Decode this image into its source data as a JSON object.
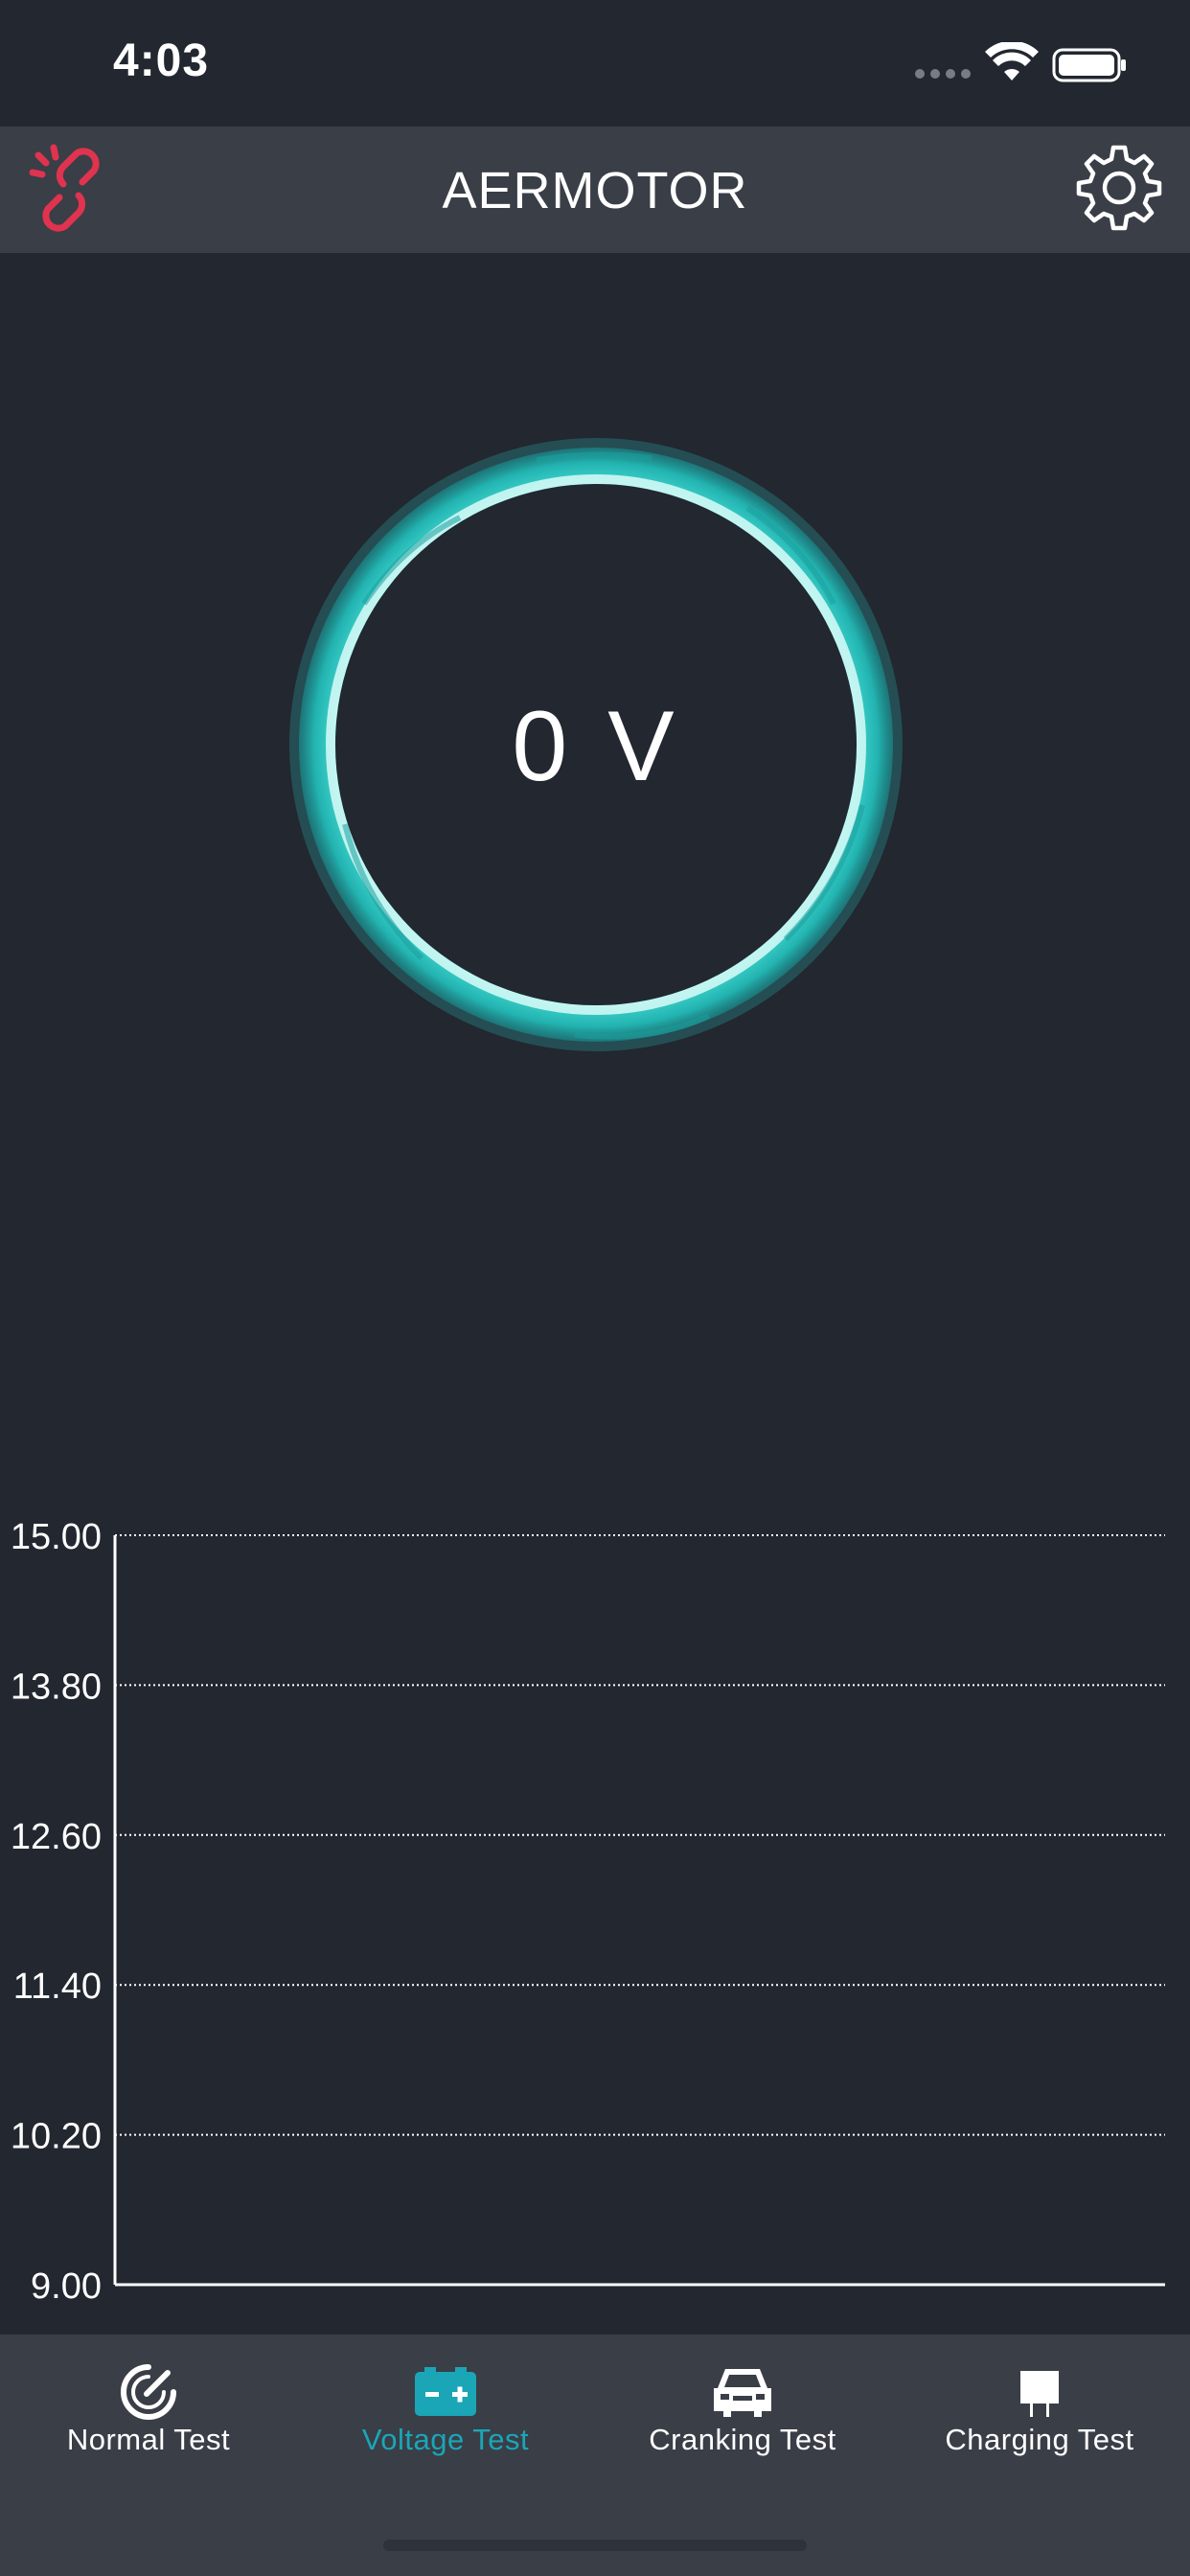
{
  "status_bar": {
    "time": "4:03"
  },
  "header": {
    "title": "AERMOTOR",
    "link_icon": "broken-link-icon",
    "settings_icon": "gear-icon",
    "link_icon_color": "#e0334f"
  },
  "gauge": {
    "value": "0",
    "unit": "V",
    "ring_color": "#2fc7c0"
  },
  "chart_data": {
    "type": "line",
    "title": "",
    "xlabel": "",
    "ylabel": "",
    "ylim": [
      9.0,
      15.0
    ],
    "y_ticks": [
      "15.00",
      "13.80",
      "12.60",
      "11.40",
      "10.20",
      "9.00"
    ],
    "grid": true,
    "series": []
  },
  "tab_bar": {
    "active_color": "#1aa6b7",
    "tabs": [
      {
        "label": "Normal Test",
        "icon": "gauge-icon",
        "active": false
      },
      {
        "label": "Voltage Test",
        "icon": "battery-icon",
        "active": true
      },
      {
        "label": "Cranking Test",
        "icon": "car-icon",
        "active": false
      },
      {
        "label": "Charging Test",
        "icon": "charger-icon",
        "active": false
      }
    ]
  }
}
